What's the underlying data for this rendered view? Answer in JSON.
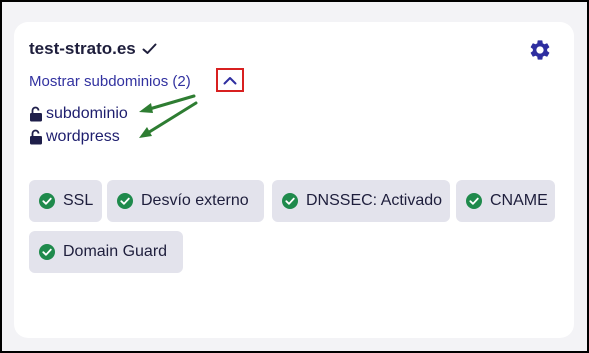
{
  "domain": {
    "name": "test-strato.es"
  },
  "subdomains_toggle": {
    "label": "Mostrar subdominios (2)"
  },
  "subdomains": [
    {
      "name": "subdominio"
    },
    {
      "name": "wordpress"
    }
  ],
  "features": [
    {
      "label": "SSL"
    },
    {
      "label": "Desvío externo"
    },
    {
      "label": "DNSSEC: Activado"
    },
    {
      "label": "CNAME"
    },
    {
      "label": "Domain Guard"
    }
  ],
  "icons": {
    "verified": "check-icon",
    "settings": "gear-icon",
    "toggle": "chevron-up-icon",
    "subdomain": "unlocked-padlock-icon",
    "feature": "check-circle-icon"
  },
  "colors": {
    "accent": "#3232a0",
    "feature_ok": "#1f8a4c",
    "annotation_arrow": "#2e7d32",
    "annotation_box": "#d82020",
    "chip_bg": "#e3e3ec"
  }
}
